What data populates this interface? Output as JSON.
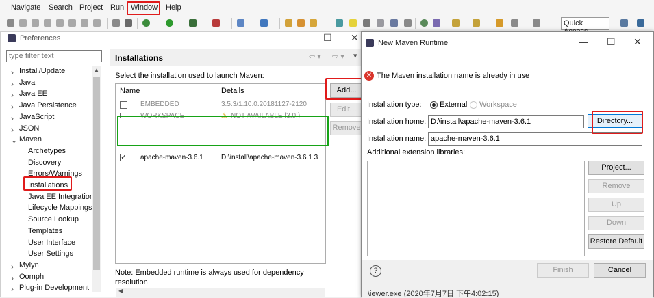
{
  "menubar": {
    "items": [
      "Navigate",
      "Search",
      "Project",
      "Run",
      "Window",
      "Help"
    ],
    "quick_access": "Quick Access"
  },
  "preferences": {
    "title": "Preferences",
    "filter_placeholder": "type filter text",
    "tree": [
      {
        "label": "Install/Update",
        "expanded": false
      },
      {
        "label": "Java",
        "expanded": false
      },
      {
        "label": "Java EE",
        "expanded": false
      },
      {
        "label": "Java Persistence",
        "expanded": false
      },
      {
        "label": "JavaScript",
        "expanded": false
      },
      {
        "label": "JSON",
        "expanded": false
      },
      {
        "label": "Maven",
        "expanded": true
      },
      {
        "label": "Archetypes",
        "child": true
      },
      {
        "label": "Discovery",
        "child": true
      },
      {
        "label": "Errors/Warnings",
        "child": true
      },
      {
        "label": "Installations",
        "child": true,
        "selected": true
      },
      {
        "label": "Java EE Integration",
        "child": true
      },
      {
        "label": "Lifecycle Mappings",
        "child": true
      },
      {
        "label": "Source Lookup",
        "child": true
      },
      {
        "label": "Templates",
        "child": true
      },
      {
        "label": "User Interface",
        "child": true
      },
      {
        "label": "User Settings",
        "child": true
      },
      {
        "label": "Mylyn",
        "expanded": false
      },
      {
        "label": "Oomph",
        "expanded": false
      },
      {
        "label": "Plug-in Development",
        "expanded": false
      }
    ],
    "page_title": "Installations",
    "description": "Select the installation used to launch Maven:",
    "columns": [
      "Name",
      "Details"
    ],
    "rows": [
      {
        "checked": false,
        "name": "EMBEDDED",
        "details": "3.5.3/1.10.0.20181127-2120",
        "greyed": true
      },
      {
        "checked": false,
        "name": "WORKSPACE",
        "details": "NOT AVAILABLE [3.0,)",
        "greyed": true,
        "warning": true
      },
      {
        "checked": true,
        "name": "apache-maven-3.6.1",
        "details": "D:\\install\\apache-maven-3.6.1 3",
        "greyed": false
      }
    ],
    "buttons": {
      "add": "Add...",
      "edit": "Edit...",
      "remove": "Remove"
    },
    "note": "Note: Embedded runtime is always used for dependency resolution"
  },
  "dialog": {
    "title": "New Maven Runtime",
    "error": "The Maven installation name is already in use",
    "install_type_label": "Installation type:",
    "type_external": "External",
    "type_workspace": "Workspace",
    "home_label": "Installation home:",
    "home_value": "D:\\install\\apache-maven-3.6.1",
    "name_label": "Installation name:",
    "name_value": "apache-maven-3.6.1",
    "libs_label": "Additional extension libraries:",
    "buttons": {
      "directory": "Directory...",
      "project": "Project...",
      "remove": "Remove",
      "up": "Up",
      "down": "Down",
      "restore": "Restore Default",
      "finish": "Finish",
      "cancel": "Cancel"
    },
    "help": "?"
  },
  "background_text": "\\iewer.exe (2020年7月7日 下午4:02:15)",
  "colors": {
    "annotation_red": "#e01b1b",
    "annotation_green": "#17a317",
    "selection": "#cce8ff",
    "error": "#d9352c"
  }
}
